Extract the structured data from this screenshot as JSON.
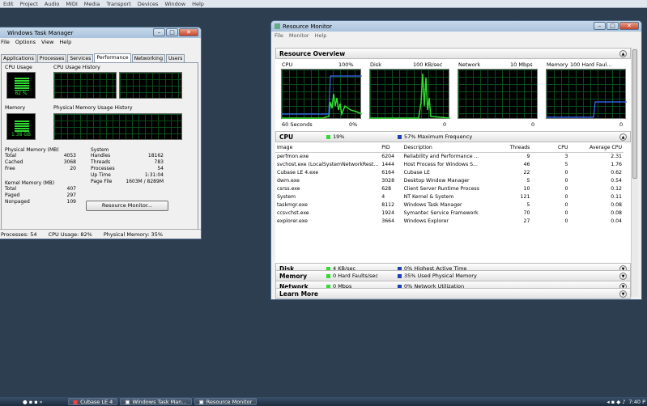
{
  "topmenu": [
    "Edit",
    "Project",
    "Audio",
    "MIDI",
    "Media",
    "Transport",
    "Devices",
    "Window",
    "Help"
  ],
  "taskmgr": {
    "title": "Windows Task Manager",
    "menu": [
      "File",
      "Options",
      "View",
      "Help"
    ],
    "tabs": [
      "Applications",
      "Processes",
      "Services",
      "Performance",
      "Networking",
      "Users"
    ],
    "cpu_usage_label": "CPU Usage",
    "cpu_history_label": "CPU Usage History",
    "cpu_value": "82 %",
    "memory_label": "Memory",
    "mem_history_label": "Physical Memory Usage History",
    "mem_value": "1.38 GB",
    "physmem": {
      "head": "Physical Memory (MB)",
      "rows": [
        [
          "Total",
          "4053"
        ],
        [
          "Cached",
          "3068"
        ],
        [
          "Free",
          "20"
        ]
      ]
    },
    "kernel": {
      "head": "Kernel Memory (MB)",
      "rows": [
        [
          "Total",
          "407"
        ],
        [
          "Paged",
          "297"
        ],
        [
          "Nonpaged",
          "109"
        ]
      ]
    },
    "system": {
      "head": "System",
      "rows": [
        [
          "Handles",
          "18162"
        ],
        [
          "Threads",
          "783"
        ],
        [
          "Processes",
          "54"
        ],
        [
          "Up Time",
          "1:31:04"
        ],
        [
          "Page File",
          "1603M / 8289M"
        ]
      ]
    },
    "resmon_button": "Resource Monitor...",
    "status": [
      "Processes: 54",
      "CPU Usage: 82%",
      "Physical Memory: 35%"
    ]
  },
  "resmon": {
    "title": "Resource Monitor",
    "menu": [
      "File",
      "Monitor",
      "Help"
    ],
    "overview": "Resource Overview",
    "graphs": [
      {
        "name": "CPU",
        "value": "100%",
        "bottom_left": "60 Seconds",
        "bottom_right": "0%"
      },
      {
        "name": "Disk",
        "value": "100 KB/sec",
        "bottom_right": "0"
      },
      {
        "name": "Network",
        "value": "10 Mbps",
        "bottom_right": "0"
      },
      {
        "name": "Memory",
        "value": "100 Hard Faul...",
        "bottom_right": "0"
      }
    ],
    "cpu": {
      "head": "CPU",
      "info1": "19%",
      "info2": "57% Maximum Frequency"
    },
    "columns": [
      "Image",
      "PID",
      "Description",
      "Threads",
      "CPU",
      "Average CPU"
    ],
    "rows": [
      [
        "perfmon.exe",
        "6204",
        "Reliability and Performance ...",
        "9",
        "3",
        "2.31"
      ],
      [
        "svchost.exe (LocalSystemNetworkRest...",
        "1444",
        "Host Process for Windows S...",
        "46",
        "5",
        "1.76"
      ],
      [
        "Cubase LE 4.exe",
        "6164",
        "Cubase LE",
        "22",
        "0",
        "0.62"
      ],
      [
        "dwm.exe",
        "3028",
        "Desktop Window Manager",
        "5",
        "0",
        "0.54"
      ],
      [
        "csrss.exe",
        "628",
        "Client Server Runtime Process",
        "10",
        "0",
        "0.12"
      ],
      [
        "System",
        "4",
        "NT Kernel & System",
        "121",
        "0",
        "0.11"
      ],
      [
        "taskmgr.exe",
        "8112",
        "Windows Task Manager",
        "5",
        "0",
        "0.08"
      ],
      [
        "ccsvchst.exe",
        "1924",
        "Symantec Service Framework",
        "70",
        "0",
        "0.08"
      ],
      [
        "explorer.exe",
        "3664",
        "Windows Explorer",
        "27",
        "0",
        "0.04"
      ]
    ],
    "disk": {
      "head": "Disk",
      "info1": "4 KB/sec",
      "info2": "0% Highest Active Time"
    },
    "network": {
      "head": "Network",
      "info1": "0 Mbps",
      "info2": "0% Network Utilization"
    },
    "memory": {
      "head": "Memory",
      "info1": "0 Hard Faults/sec",
      "info2": "35% Used Physical Memory"
    },
    "learn": {
      "head": "Learn More"
    }
  },
  "taskbar": {
    "apps": [
      "Cubase LE 4",
      "Windows Task Man...",
      "Resource Monitor"
    ],
    "clock": "7:40 P"
  },
  "colors": {
    "green": "#2fdc2f",
    "blue": "#1d3fb8",
    "graph_bg": "#000000"
  }
}
